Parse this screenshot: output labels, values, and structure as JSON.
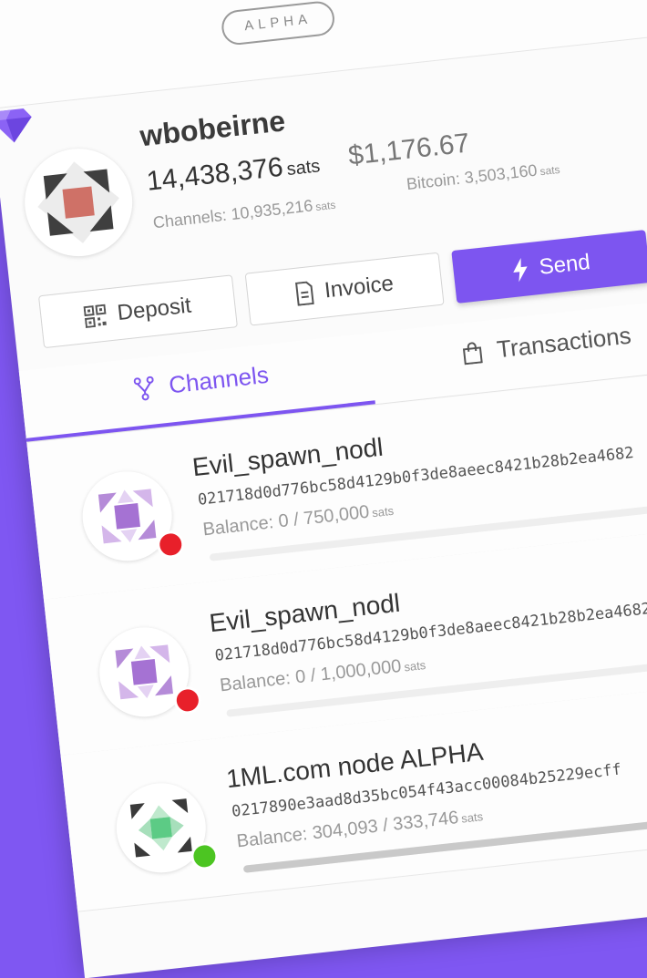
{
  "header": {
    "badge": "ALPHA"
  },
  "account": {
    "username": "wbobeirne",
    "total_balance": "14,438,376",
    "total_unit": "sats",
    "fiat_value": "$1,176.67",
    "channels_label": "Channels: 10,935,216",
    "channels_unit": "sats",
    "bitcoin_label": "Bitcoin: 3,503,160",
    "bitcoin_unit": "sats"
  },
  "actions": {
    "deposit": "Deposit",
    "invoice": "Invoice",
    "send": "Send"
  },
  "tabs": {
    "channels": "Channels",
    "transactions": "Transactions"
  },
  "channels": [
    {
      "name": "Evil_spawn_nodl",
      "pubkey": "021718d0d776bc58d4129b0f3de8aeec8421b28b2ea4682",
      "balance": "Balance: 0 / 750,000",
      "unit": "sats",
      "status": "offline",
      "fill": 0
    },
    {
      "name": "Evil_spawn_nodl",
      "pubkey": "021718d0d776bc58d4129b0f3de8aeec8421b28b2ea4682",
      "balance": "Balance: 0 / 1,000,000",
      "unit": "sats",
      "status": "offline",
      "fill": 0
    },
    {
      "name": "1ML.com node ALPHA",
      "pubkey": "0217890e3aad8d35bc054f43acc00084b25229ecff",
      "balance": "Balance: 304,093 / 333,746",
      "unit": "sats",
      "status": "online",
      "fill": 0.911
    }
  ],
  "colors": {
    "accent": "#7d55f0",
    "offline": "#e8202a",
    "online": "#4cc522",
    "background": "#7f57f2"
  },
  "icons": {
    "menu": "hamburger-icon",
    "logo": "gem-icon",
    "deposit": "qr-code-icon",
    "invoice": "document-icon",
    "send": "lightning-icon",
    "channels": "fork-icon",
    "transactions": "shopping-bag-icon"
  }
}
